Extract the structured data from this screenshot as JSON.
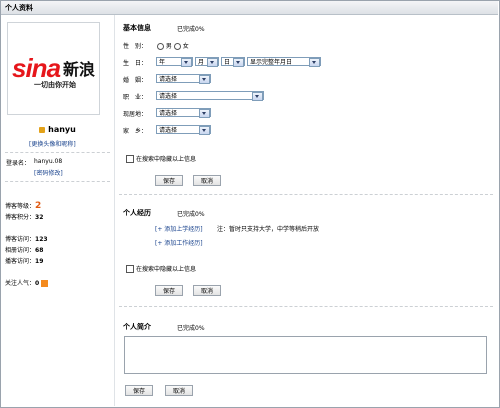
{
  "title": "个人资料",
  "left": {
    "logo_brand": "sina新浪",
    "logo_slogan": "一切由你开始",
    "username": "hanyu",
    "change_avatar_link": "[更换头像和昵称]",
    "login_label": "登录名：",
    "login_name": "hanyu.08",
    "change_password_link": "[密码修改]",
    "blog_level_label": "博客等级：",
    "blog_level_value": "2",
    "blog_points_label": "博客积分：",
    "blog_points_value": "32",
    "blog_visits_label": "博客访问：",
    "blog_visits_value": "123",
    "album_visits_label": "相册访问：",
    "album_visits_value": "68",
    "podcast_visits_label": "播客访问：",
    "podcast_visits_value": "19",
    "popularity_label": "关注人气：",
    "popularity_value": "0"
  },
  "basic": {
    "heading": "基本信息",
    "progress": "已完成0%",
    "gender_label": "性　别：",
    "gender_male": "男",
    "gender_female": "女",
    "birthday_label": "生　日：",
    "year_value": "年",
    "month_value": "月",
    "day_value": "日",
    "display_option": "显示完整年月日",
    "marriage_label": "婚　姻：",
    "marriage_value": "请选择",
    "job_label": "职　业：",
    "job_value": "请选择",
    "residence_label": "现居地：",
    "residence_value": "请选择",
    "hometown_label": "家　乡：",
    "hometown_value": "请选择",
    "hide_label": "在搜索中隐藏以上信息",
    "save_label": "保存",
    "cancel_label": "取消"
  },
  "experience": {
    "heading": "个人经历",
    "progress": "已完成0%",
    "add_education": "[+ 添加上学经历]",
    "note": "注：暂时只支持大学，中学等稍后开放",
    "add_work": "[+ 添加工作经历]",
    "hide_label": "在搜索中隐藏以上信息",
    "save_label": "保存",
    "cancel_label": "取消"
  },
  "intro": {
    "heading": "个人简介",
    "progress": "已完成0%",
    "text": "",
    "save_label": "保存",
    "cancel_label": "取消"
  }
}
